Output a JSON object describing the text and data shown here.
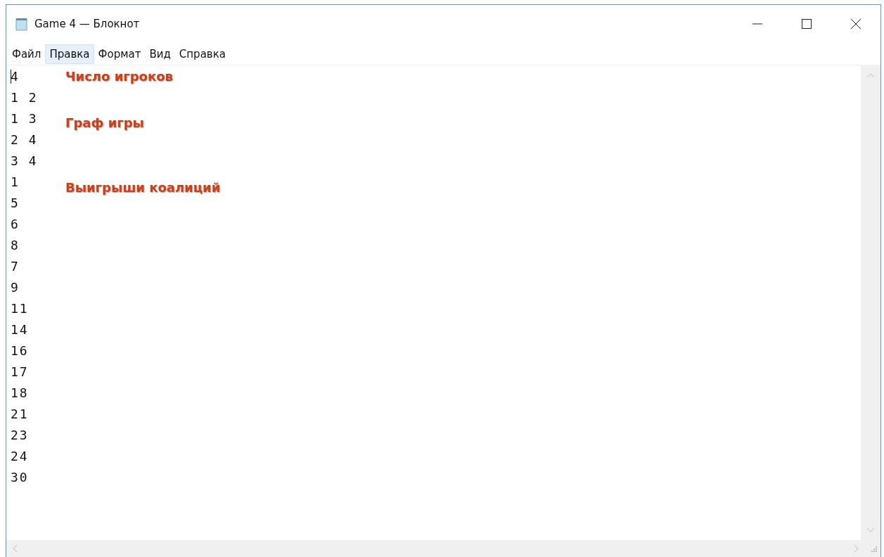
{
  "window": {
    "title": "Game 4 — Блокнот"
  },
  "menu": [
    {
      "label": "Файл",
      "selected": false
    },
    {
      "label": "Правка",
      "selected": true
    },
    {
      "label": "Формат",
      "selected": false
    },
    {
      "label": "Вид",
      "selected": false
    },
    {
      "label": "Справка",
      "selected": false
    }
  ],
  "editor": {
    "lines": [
      {
        "text": "4",
        "note": "Число игроков"
      },
      {
        "text": "1 2"
      },
      {
        "text": "1 3",
        "note": "Граф игры"
      },
      {
        "text": "2 4"
      },
      {
        "text": "3 4"
      },
      {
        "text": "1",
        "note": "Выигрыши коалиций"
      },
      {
        "text": "5"
      },
      {
        "text": "6"
      },
      {
        "text": "8"
      },
      {
        "text": "7"
      },
      {
        "text": "9"
      },
      {
        "text": "11"
      },
      {
        "text": "14"
      },
      {
        "text": "16"
      },
      {
        "text": "17"
      },
      {
        "text": "18"
      },
      {
        "text": "21"
      },
      {
        "text": "23"
      },
      {
        "text": "24"
      },
      {
        "text": "30"
      }
    ]
  }
}
